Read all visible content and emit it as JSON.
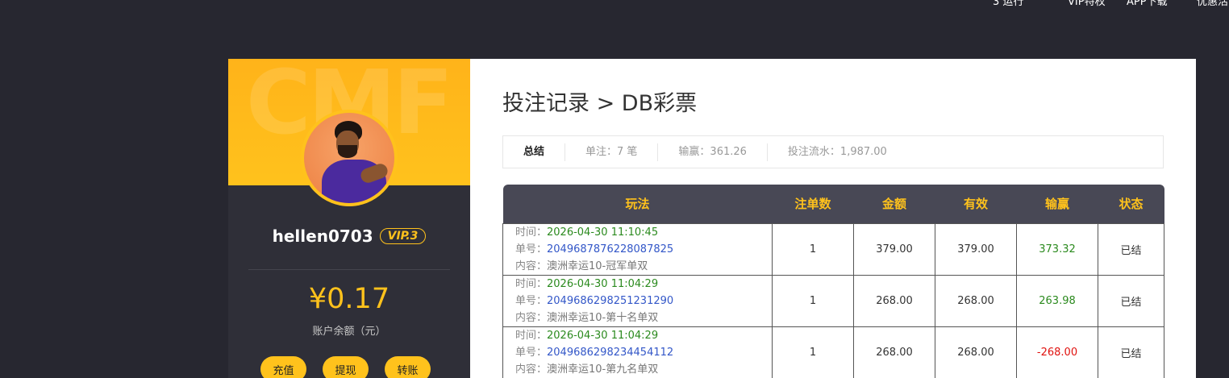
{
  "topnav": [
    "3 运行",
    "VIP特权",
    "APP下载",
    "优惠活"
  ],
  "profile": {
    "watermark": "CMF",
    "username": "hellen0703",
    "vip": "VIP.3",
    "balance": "¥0.17",
    "balance_label": "账户余额（元）",
    "actions": [
      "充值",
      "提现",
      "转账"
    ]
  },
  "main": {
    "title": "投注记录 > DB彩票",
    "summary": {
      "label": "总结",
      "orders": "单注：7 笔",
      "profit": "输赢：361.26",
      "turnover": "投注流水：1,987.00"
    },
    "columns": [
      "玩法",
      "注单数",
      "金额",
      "有效",
      "输赢",
      "状态"
    ],
    "info_labels": {
      "time": "时间：",
      "order": "单号：",
      "content": "内容："
    },
    "rows": [
      {
        "time": "2026-04-30 11:10:45",
        "order": "2049687876228087825",
        "content": "澳洲幸运10-冠军单双",
        "count": "1",
        "amount": "379.00",
        "valid": "379.00",
        "profit": "373.32",
        "status": "已结"
      },
      {
        "time": "2026-04-30 11:04:29",
        "order": "2049686298251231290",
        "content": "澳洲幸运10-第十名单双",
        "count": "1",
        "amount": "268.00",
        "valid": "268.00",
        "profit": "263.98",
        "status": "已结"
      },
      {
        "time": "2026-04-30 11:04:29",
        "order": "2049686298234454112",
        "content": "澳洲幸运10-第九名单双",
        "count": "1",
        "amount": "268.00",
        "valid": "268.00",
        "profit": "-268.00",
        "status": "已结"
      }
    ]
  },
  "colors": {
    "accent": "#ffc21c",
    "win": "#2b8a1e",
    "lose": "#e0120f",
    "link": "#3357c8"
  }
}
